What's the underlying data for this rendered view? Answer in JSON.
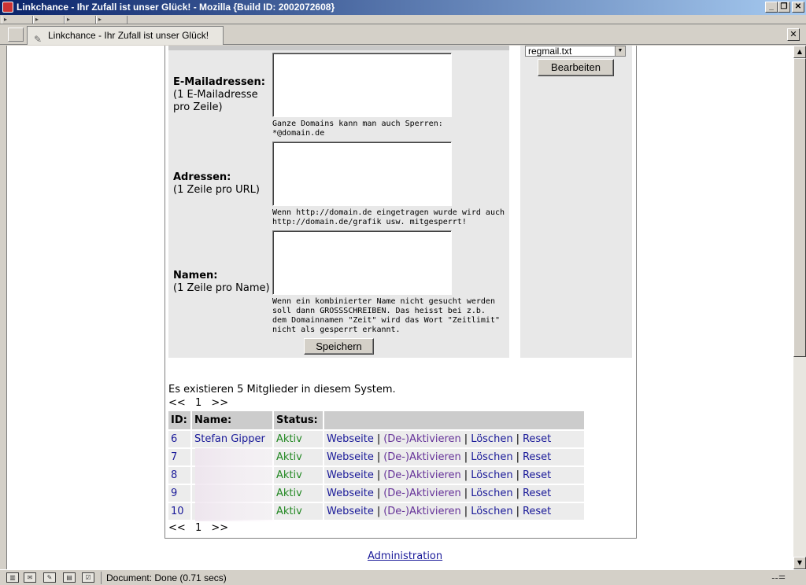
{
  "window": {
    "title": "Linkchance - Ihr Zufall ist unser Glück! - Mozilla {Build ID: 2002072608}",
    "minimize": "_",
    "maximize": "❐",
    "close": "✕"
  },
  "tabs": [
    {
      "label": "Linkchance - Ihr Zufall ist unser Glück!"
    }
  ],
  "form": {
    "email": {
      "label": "E-Mailadressen:",
      "sub": "(1 E-Mailadresse pro Zeile)",
      "hint1": "Ganze Domains kann man auch Sperren:",
      "hint2": "*@domain.de"
    },
    "urls": {
      "label": "Adressen:",
      "sub": "(1 Zeile pro URL)",
      "hint1": "Wenn http://domain.de eingetragen wurde wird auch",
      "hint2": "http://domain.de/grafik usw. mitgesperrt!"
    },
    "names": {
      "label": "Namen:",
      "sub": "(1 Zeile pro Name)",
      "hint1": "Wenn ein kombinierter Name nicht gesucht werden",
      "hint2": "soll dann GROSSSCHREIBEN. Das heisst bei z.b.",
      "hint3": "dem Domainnamen \"Zeit\" wird das Wort \"Zeitlimit\"",
      "hint4": "nicht als gesperrt erkannt."
    },
    "save_button": "Speichern"
  },
  "side": {
    "select_value": "regmail.txt",
    "edit_button": "Bearbeiten"
  },
  "members": {
    "count_text": "Es existieren 5 Mitglieder in diesem System.",
    "pager": {
      "prev": "<<",
      "page": "1",
      "next": ">>"
    },
    "headers": {
      "id": "ID:",
      "name": "Name:",
      "status": "Status:"
    },
    "rows": [
      {
        "id": "6",
        "name": "Stefan Gipper",
        "status": "Aktiv"
      },
      {
        "id": "7",
        "name": "",
        "status": "Aktiv"
      },
      {
        "id": "8",
        "name": "",
        "status": "Aktiv"
      },
      {
        "id": "9",
        "name": "",
        "status": "Aktiv"
      },
      {
        "id": "10",
        "name": "",
        "status": "Aktiv"
      }
    ],
    "actions": {
      "website": "Webseite",
      "toggle": "(De-)Aktivieren",
      "delete": "Löschen",
      "reset": "Reset",
      "separator": "|"
    }
  },
  "footer": {
    "admin_link": "Administration"
  },
  "status_bar": {
    "text": "Document: Done (0.71 secs)"
  }
}
